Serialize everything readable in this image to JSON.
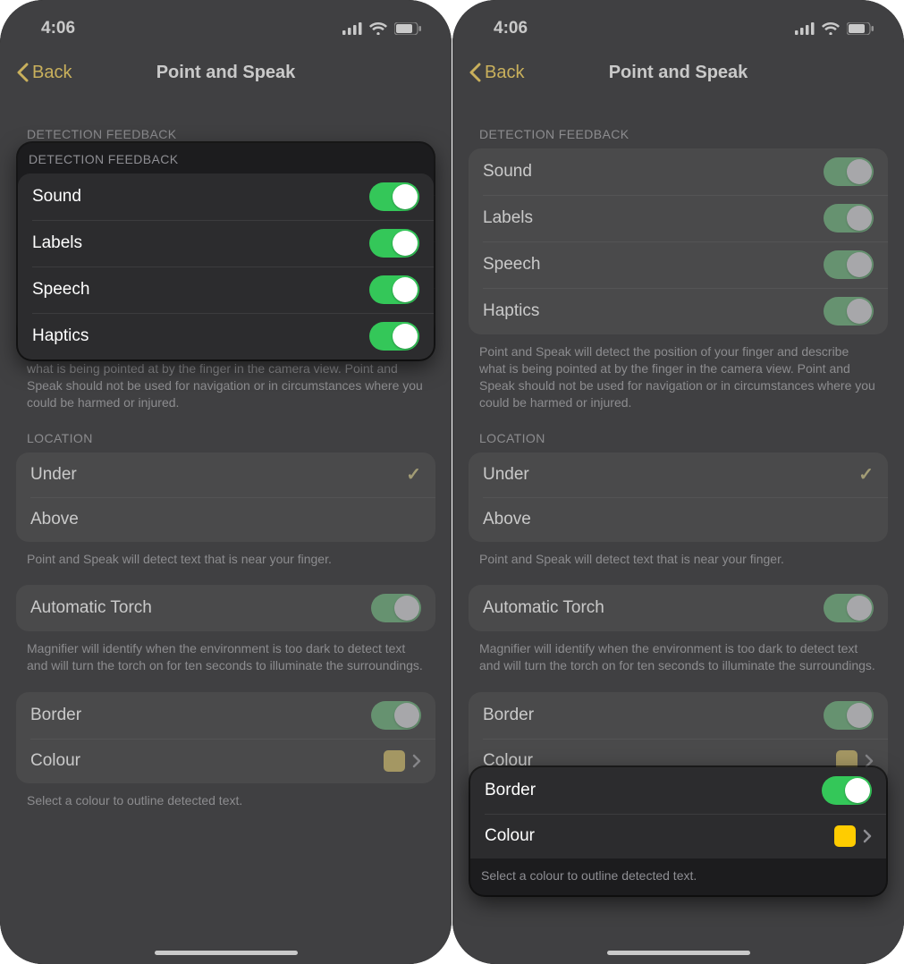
{
  "status": {
    "time": "4:06"
  },
  "header": {
    "back": "Back",
    "title": "Point and Speak"
  },
  "detection": {
    "header": "DETECTION FEEDBACK",
    "items": [
      {
        "label": "Sound",
        "on": true
      },
      {
        "label": "Labels",
        "on": true
      },
      {
        "label": "Speech",
        "on": true
      },
      {
        "label": "Haptics",
        "on": true
      }
    ],
    "footer": "Point and Speak will detect the position of your finger and describe what is being pointed at by the finger in the camera view. Point and Speak should not be used for navigation or in circumstances where you could be harmed or injured."
  },
  "location": {
    "header": "LOCATION",
    "items": [
      {
        "label": "Under",
        "selected": true
      },
      {
        "label": "Above",
        "selected": false
      }
    ],
    "footer": "Point and Speak will detect text that is near your finger."
  },
  "torch": {
    "label": "Automatic Torch",
    "on": true,
    "footer": "Magnifier will identify when the environment is too dark to detect text and will turn the torch on for ten seconds to illuminate the surroundings."
  },
  "border": {
    "border_label": "Border",
    "border_on": true,
    "colour_label": "Colour",
    "colour_value": "#ffcc00",
    "footer": "Select a colour to outline detected text."
  }
}
